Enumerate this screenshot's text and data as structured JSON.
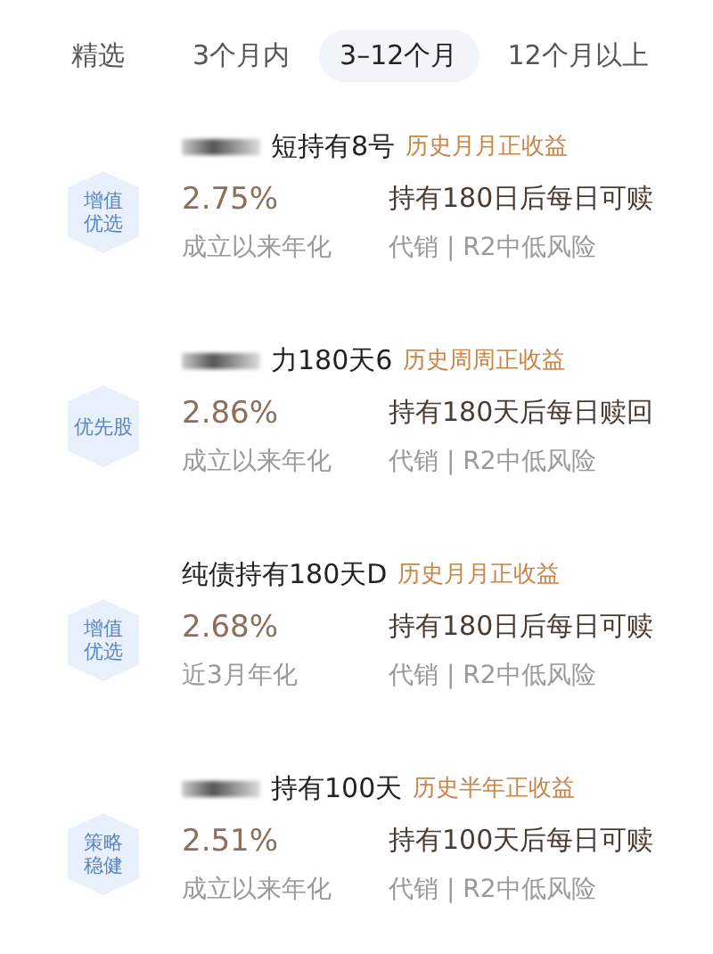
{
  "tabs": [
    {
      "label": "精选",
      "selected": false
    },
    {
      "label": "3个月内",
      "selected": false
    },
    {
      "label": "3–12个月",
      "selected": true
    },
    {
      "label": "12个月以上",
      "selected": false
    }
  ],
  "products": [
    {
      "badge": [
        "增值",
        "优选"
      ],
      "redacted": true,
      "name": "短持有8号",
      "tag": "历史月月正收益",
      "rate": "2.75%",
      "rate_label": "成立以来年化",
      "redemption": "持有180日后每日可赎",
      "risk": "代销 | R2中低风险"
    },
    {
      "badge": [
        "优先股"
      ],
      "redacted": true,
      "name": "力180天6",
      "tag": "历史周周正收益",
      "rate": "2.86%",
      "rate_label": "成立以来年化",
      "redemption": "持有180天后每日赎回",
      "risk": "代销 | R2中低风险"
    },
    {
      "badge": [
        "增值",
        "优选"
      ],
      "redacted": false,
      "name": "纯债持有180天D",
      "tag": "历史月月正收益",
      "rate": "2.68%",
      "rate_label": "近3月年化",
      "redemption": "持有180日后每日可赎",
      "risk": "代销 | R2中低风险"
    },
    {
      "badge": [
        "策略",
        "稳健"
      ],
      "redacted": true,
      "name": "持有100天",
      "tag": "历史半年正收益",
      "rate": "2.51%",
      "rate_label": "成立以来年化",
      "redemption": "持有100天后每日可赎",
      "risk": "代销 | R2中低风险"
    }
  ]
}
